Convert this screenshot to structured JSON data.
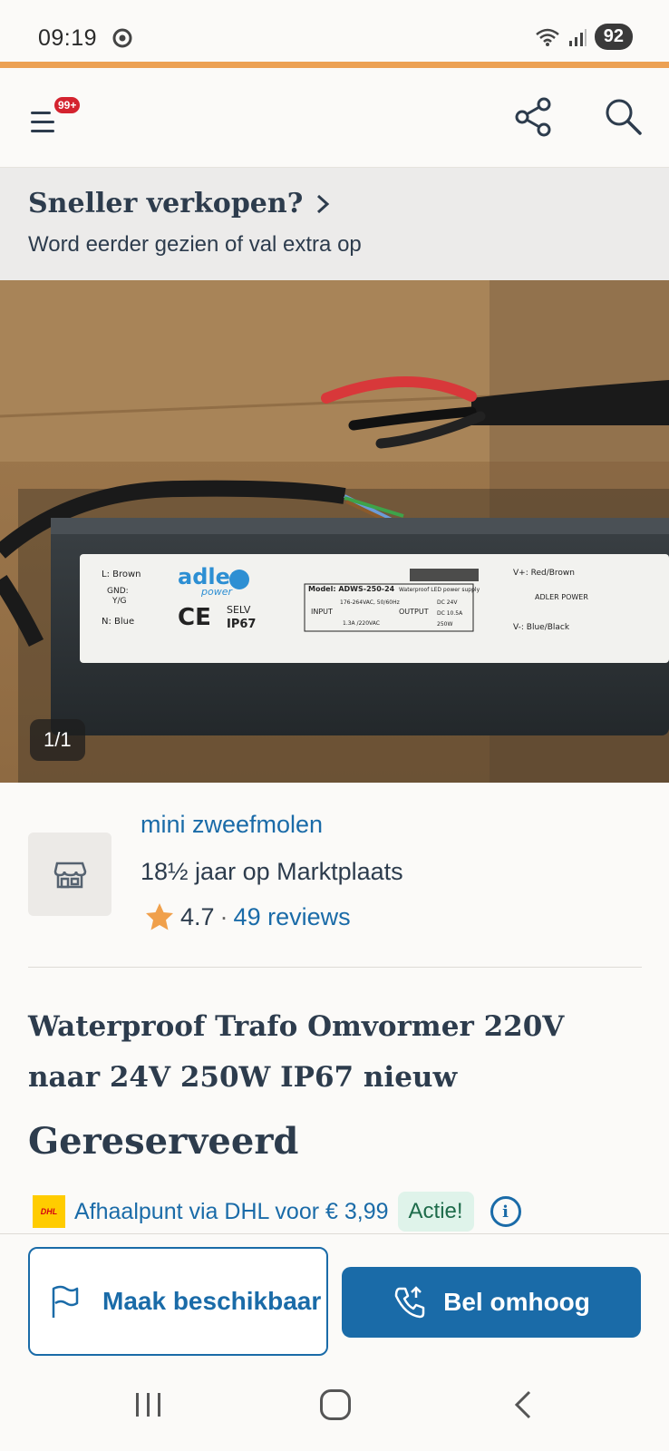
{
  "status_bar": {
    "time": "09:19",
    "battery": "92"
  },
  "header": {
    "badge": "99+",
    "icons": [
      "menu-icon",
      "share-icon",
      "search-icon"
    ]
  },
  "promo": {
    "title": "Sneller verkopen?",
    "subtitle": "Word eerder gezien of val extra op"
  },
  "gallery": {
    "counter": "1/1",
    "label_texts": {
      "l_brown": "L: Brown",
      "gnd": "GND:",
      "yg": "Y/G",
      "n_blue": "N: Blue",
      "input": "INPUT",
      "brand": "adler",
      "brand_sub": "power",
      "ce": "CE",
      "selv": "SELV",
      "ip": "IP67",
      "model": "Model: ADWS-250-24",
      "waterproof": "Waterproof LED power supply",
      "in_label": "INPUT",
      "in_v": "176-264VAC, 50/60Hz",
      "in_a": "1.3A /220VAC",
      "out_label": "OUTPUT",
      "out_v": "DC 24V",
      "out_a": "DC 10.5A",
      "out_w": "250W",
      "vplus": "V+: Red/Brown",
      "vminus": "V-: Blue/Black",
      "maker": "ADLER POWER",
      "output": "OUTPUT"
    }
  },
  "seller": {
    "name": "mini zweefmolen",
    "years": "18½ jaar op Marktplaats",
    "rating": "4.7",
    "separator": "·",
    "reviews": "49 reviews",
    "star_color": "#f0a04b"
  },
  "ad": {
    "title": "Waterproof Trafo Omvormer 220V naar 24V 250W IP67 nieuw",
    "status": "Gereserveerd"
  },
  "shipping": {
    "carrier_logo": "DHL",
    "text": "Afhaalpunt via DHL voor € 3,99",
    "badge": "Actie!",
    "info": "i"
  },
  "actions": {
    "make_available": "Maak beschikbaar",
    "bump": "Bel omhoog"
  },
  "colors": {
    "accent": "#1a6ba8",
    "header_line": "#eca154",
    "text": "#2d3c4d"
  }
}
